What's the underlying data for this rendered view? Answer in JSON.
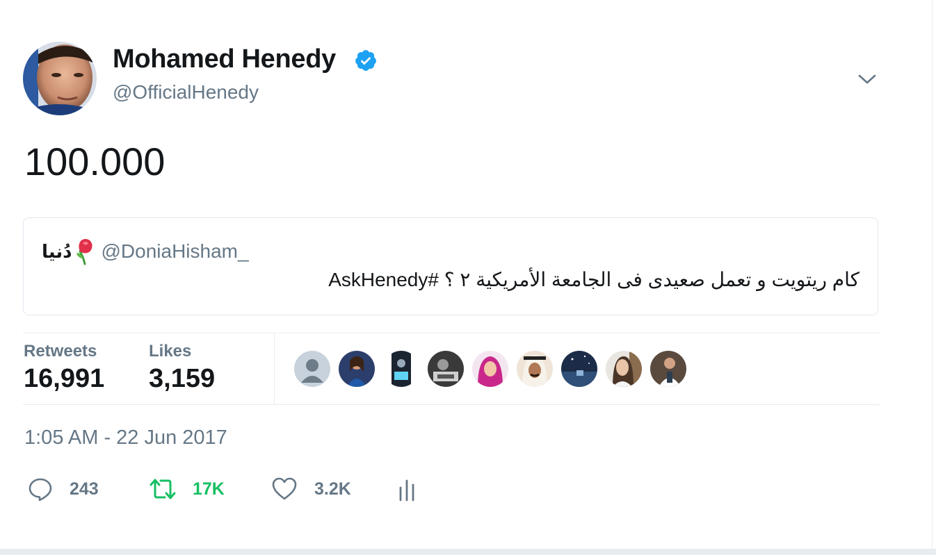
{
  "tweet": {
    "author": {
      "display_name": "Mohamed Henedy",
      "handle": "@OfficialHenedy",
      "verified": true,
      "avatar_icon": "profile-photo"
    },
    "text": "100.000",
    "quoted": {
      "display_name": "دُنيا",
      "name_emoji": "wilted-rose",
      "handle": "@DoniaHisham_",
      "text": "كام ريتويت و تعمل صعيدى فى الجامعة الأمريكية ٢ ؟ #AskHenedy"
    },
    "stats": {
      "retweets_label": "Retweets",
      "retweets_value": "16,991",
      "likes_label": "Likes",
      "likes_value": "3,159"
    },
    "likers": [
      {
        "icon": "default-avatar"
      },
      {
        "icon": "profile-photo"
      },
      {
        "icon": "profile-photo"
      },
      {
        "icon": "profile-photo"
      },
      {
        "icon": "profile-photo"
      },
      {
        "icon": "profile-photo"
      },
      {
        "icon": "profile-photo"
      },
      {
        "icon": "profile-photo"
      },
      {
        "icon": "profile-photo"
      }
    ],
    "timestamp": "1:05 AM - 22 Jun 2017",
    "actions": {
      "reply_count": "243",
      "retweet_count": "17K",
      "like_count": "3.2K"
    }
  },
  "colors": {
    "primary_text": "#14171a",
    "secondary_text": "#657786",
    "verified_blue": "#1da1f2",
    "retweet_green": "#17bf63",
    "border": "#e1e8ed"
  }
}
